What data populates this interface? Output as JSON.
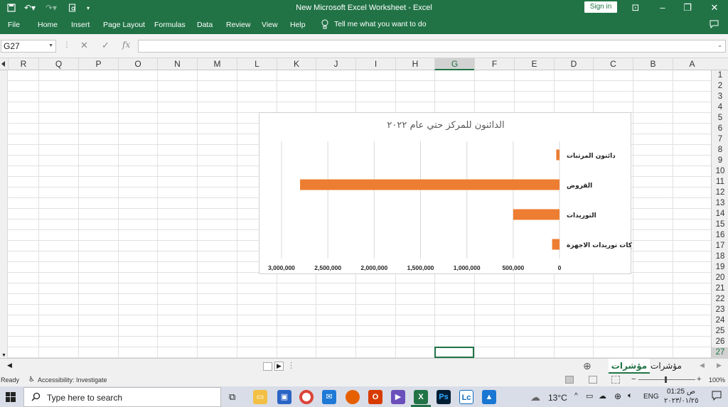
{
  "titlebar": {
    "title": "New Microsoft Excel Worksheet  -  Excel",
    "signin": "Sign in"
  },
  "ribbon": {
    "tabs": [
      "File",
      "Home",
      "Insert",
      "Page Layout",
      "Formulas",
      "Data",
      "Review",
      "View",
      "Help"
    ],
    "tell_me": "Tell me what you want to do"
  },
  "formula_bar": {
    "name_box": "G27",
    "fx": "fx",
    "value": ""
  },
  "grid": {
    "columns": [
      "R",
      "Q",
      "P",
      "O",
      "N",
      "M",
      "L",
      "K",
      "J",
      "I",
      "H",
      "G",
      "F",
      "E",
      "D",
      "C",
      "B",
      "A"
    ],
    "selected_column": "G",
    "rows": [
      "1",
      "2",
      "3",
      "4",
      "5",
      "6",
      "7",
      "8",
      "9",
      "10",
      "11",
      "12",
      "13",
      "14",
      "15",
      "16",
      "17",
      "18",
      "19",
      "20",
      "21",
      "22",
      "23",
      "24",
      "25",
      "26",
      "27"
    ],
    "selected_row": "27"
  },
  "chart_data": {
    "type": "bar",
    "orientation": "horizontal",
    "direction": "right-to-left",
    "title": "الدائنون للمركز حتي عام ٢٠٢٢",
    "categories": [
      "دائنون المرتبات",
      "القروض",
      "التوريدات",
      "شركات توريدات الاجهزة"
    ],
    "values": [
      35000,
      2800000,
      500000,
      80000
    ],
    "xlim": [
      0,
      3000000
    ],
    "ticks": [
      "0",
      "500,000",
      "1,000,000",
      "1,500,000",
      "2,000,000",
      "2,500,000",
      "3,000,000"
    ],
    "tick_values": [
      0,
      500000,
      1000000,
      1500000,
      2000000,
      2500000,
      3000000
    ],
    "bar_color": "#ed7d31",
    "grid": true,
    "legend": "none"
  },
  "sheets": {
    "tabs": [
      "مؤشرات",
      "مؤشرات ٢"
    ],
    "active": "مؤشرات ٢"
  },
  "status": {
    "ready": "Ready",
    "accessibility": "Accessibility: Investigate",
    "zoom": "100%"
  },
  "taskbar": {
    "search_placeholder": "Type here to search",
    "weather": "13°C",
    "lang": "ENG",
    "time": "01:25 ص",
    "date": "٢٠٢٣/٠١/٢٥"
  },
  "colors": {
    "accent": "#217346",
    "bar": "#ed7d31"
  }
}
